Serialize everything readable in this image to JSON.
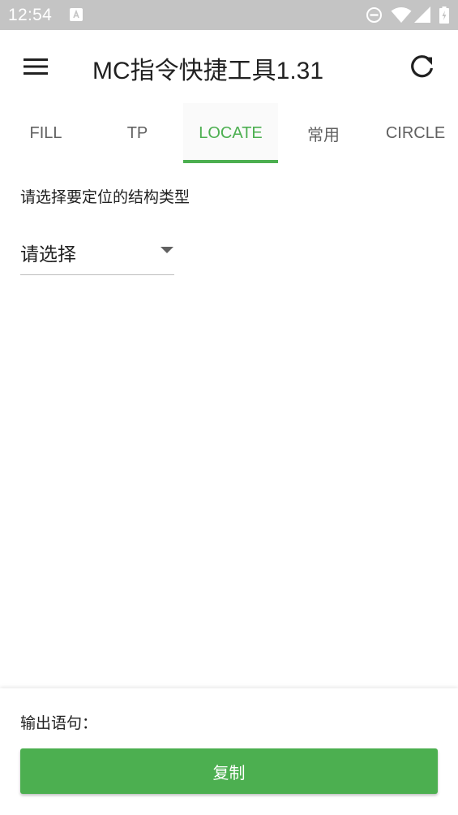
{
  "status_bar": {
    "time": "12:54",
    "icons": [
      "keyboard-notification-icon",
      "do-not-disturb-icon",
      "wifi-icon",
      "signal-icon",
      "battery-charging-icon"
    ]
  },
  "app_bar": {
    "title": "MC指令快捷工具1.31",
    "icons": [
      "menu-icon",
      "refresh-icon"
    ]
  },
  "tabs": {
    "items": [
      {
        "label": "FILL"
      },
      {
        "label": "TP"
      },
      {
        "label": "LOCATE"
      },
      {
        "label": "常用"
      },
      {
        "label": "CIRCLE"
      }
    ],
    "selected": "LOCATE"
  },
  "locate": {
    "prompt": "请选择要定位的结构类型",
    "spinner_value": "请选择"
  },
  "output": {
    "label": "输出语句：",
    "copy_label": "复制"
  },
  "colors": {
    "accent": "#4caf50",
    "status_bar_bg": "#c4c4c4",
    "text_primary": "#212121",
    "tab_inactive": "#616161"
  }
}
